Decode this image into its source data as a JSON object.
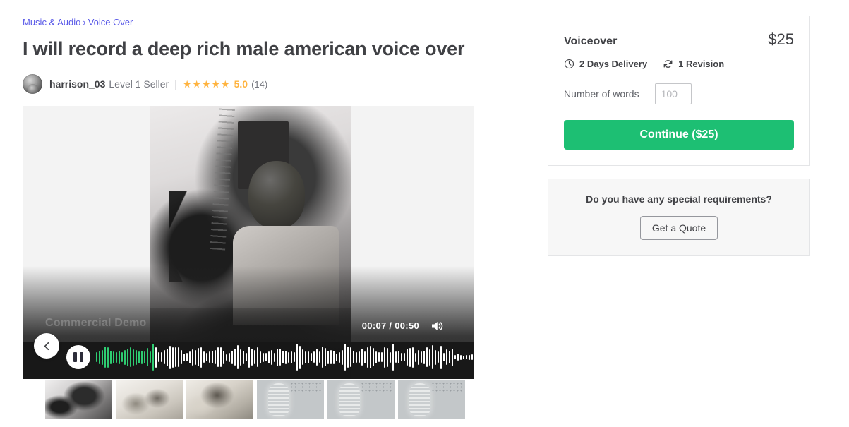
{
  "breadcrumb": {
    "items": [
      "Music & Audio",
      "Voice Over"
    ],
    "separator": "›"
  },
  "gig": {
    "title": "I will record a deep rich male american voice over"
  },
  "seller": {
    "name": "harrison_03",
    "level": "Level 1 Seller",
    "separator": "|",
    "stars": "★★★★★",
    "rating": "5.0",
    "reviews": "(14)"
  },
  "gallery": {
    "prev_label": "‹",
    "next_label": "›",
    "player": {
      "track_title": "Commercial Demo",
      "current_time": "00:07",
      "time_separator": "/",
      "total_time": "00:50",
      "time_display": "00:07 / 00:50",
      "state": "playing",
      "played_ratio": 0.16,
      "played_color": "#2ecc71",
      "unplayed_color": "#ffffff"
    },
    "thumbnails": [
      {
        "label": "thumbnail-photo-1",
        "kind": "photo"
      },
      {
        "label": "thumbnail-photo-2",
        "kind": "photo"
      },
      {
        "label": "thumbnail-photo-3",
        "kind": "photo"
      },
      {
        "label": "thumbnail-audio-1",
        "kind": "audio"
      },
      {
        "label": "thumbnail-audio-2",
        "kind": "audio"
      },
      {
        "label": "thumbnail-audio-3",
        "kind": "audio"
      }
    ]
  },
  "pricing": {
    "package_name": "Voiceover",
    "price": "$25",
    "delivery": "2 Days Delivery",
    "revisions": "1 Revision",
    "words_label": "Number of words",
    "words_placeholder": "100",
    "words_value": "",
    "continue_label": "Continue ($25)",
    "accent_color": "#1dbf73"
  },
  "quote": {
    "title": "Do you have any special requirements?",
    "button_label": "Get a Quote"
  }
}
